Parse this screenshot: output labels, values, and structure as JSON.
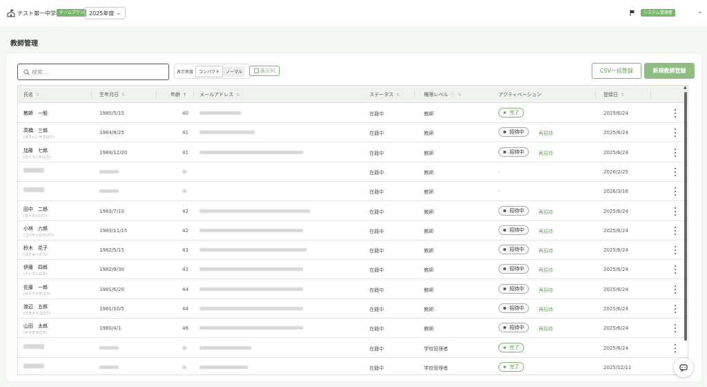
{
  "header": {
    "school_name": "テスト第一中学校",
    "plan_badge": "チームプラン",
    "year": "2025年度",
    "role_badge": "システム管理者"
  },
  "page": {
    "title": "教師管理"
  },
  "toolbar": {
    "search_placeholder": "検索...",
    "density_label": "表示密度",
    "density_options": [
      "コンパクト",
      "ノーマル"
    ],
    "density_selected": "コンパクト",
    "columns_label": "表示列",
    "csv_label": "CSV一括登録",
    "new_label": "新規教師登録"
  },
  "table": {
    "headers": {
      "name": "氏名",
      "birth": "生年月日",
      "age": "年齢",
      "email": "メールアドレス",
      "status": "ステータス",
      "role": "権限レベル",
      "activation": "アクティベーション",
      "registered": "登録日"
    },
    "rows": [
      {
        "name": "教師　一般",
        "kana": "",
        "birth": "1985/5/15",
        "age": "40",
        "status": "在籍中",
        "role": "教師",
        "activation": "完了",
        "activation_type": "done",
        "reinvite": "",
        "registered": "2025/6/24"
      },
      {
        "name": "高橋　三郎",
        "kana": "(タカハシサブロウ)",
        "birth": "1984/8/25",
        "age": "41",
        "status": "在籍中",
        "role": "教師",
        "activation": "招待中",
        "activation_type": "invite",
        "reinvite": "再招待",
        "registered": "2025/6/24"
      },
      {
        "name": "加藤　七郎",
        "kana": "(カトウシチロウ)",
        "birth": "1984/12/20",
        "age": "41",
        "status": "在籍中",
        "role": "教師",
        "activation": "招待中",
        "activation_type": "invite",
        "reinvite": "再招待",
        "registered": "2025/6/24"
      },
      {
        "name": "",
        "kana": "",
        "birth": "",
        "age": "",
        "status": "在籍中",
        "role": "教師",
        "activation": "-",
        "activation_type": "none",
        "reinvite": "",
        "registered": "2026/2/25"
      },
      {
        "name": "",
        "kana": "",
        "birth": "",
        "age": "",
        "status": "在籍中",
        "role": "教師",
        "activation": "-",
        "activation_type": "none",
        "reinvite": "",
        "registered": "2026/3/16"
      },
      {
        "name": "田中　二郎",
        "kana": "(タナカジロウ)",
        "birth": "1983/7/10",
        "age": "42",
        "status": "在籍中",
        "role": "教師",
        "activation": "招待中",
        "activation_type": "invite",
        "reinvite": "再招待",
        "registered": "2025/6/24"
      },
      {
        "name": "小林　六郎",
        "kana": "(コバヤシロクロウ)",
        "birth": "1983/11/15",
        "age": "42",
        "status": "在籍中",
        "role": "教師",
        "activation": "招待中",
        "activation_type": "invite",
        "reinvite": "再招待",
        "registered": "2025/6/24"
      },
      {
        "name": "鈴木　花子",
        "kana": "(スズキハナコ)",
        "birth": "1982/5/15",
        "age": "43",
        "status": "在籍中",
        "role": "教師",
        "activation": "招待中",
        "activation_type": "invite",
        "reinvite": "再招待",
        "registered": "2025/6/24"
      },
      {
        "name": "伊藤　四郎",
        "kana": "(イトウシロウ)",
        "birth": "1982/9/30",
        "age": "43",
        "status": "在籍中",
        "role": "教師",
        "activation": "招待中",
        "activation_type": "invite",
        "reinvite": "再招待",
        "registered": "2025/6/24"
      },
      {
        "name": "佐藤　一郎",
        "kana": "(サトウイチロウ)",
        "birth": "1981/6/20",
        "age": "44",
        "status": "在籍中",
        "role": "教師",
        "activation": "招待中",
        "activation_type": "invite",
        "reinvite": "再招待",
        "registered": "2025/6/24"
      },
      {
        "name": "渡辺　五郎",
        "kana": "(ワタナベゴロウ)",
        "birth": "1981/10/5",
        "age": "44",
        "status": "在籍中",
        "role": "教師",
        "activation": "招待中",
        "activation_type": "invite",
        "reinvite": "再招待",
        "registered": "2025/6/24"
      },
      {
        "name": "山田　太郎",
        "kana": "(ヤマダタロウ)",
        "birth": "1980/4/1",
        "age": "46",
        "status": "在籍中",
        "role": "教師",
        "activation": "招待中",
        "activation_type": "invite",
        "reinvite": "再招待",
        "registered": "2025/6/24"
      },
      {
        "name": "",
        "kana": "",
        "birth": "",
        "age": "",
        "status": "在籍中",
        "role": "学校管理者",
        "activation": "完了",
        "activation_type": "done",
        "reinvite": "",
        "registered": "2025/6/24"
      },
      {
        "name": "",
        "kana": "",
        "birth": "",
        "age": "",
        "status": "在籍中",
        "role": "学校管理者",
        "activation": "完了",
        "activation_type": "done",
        "reinvite": "",
        "registered": "2025/12/11"
      }
    ]
  },
  "colors": {
    "accent": "#7cb66e",
    "accent_dark": "#5a9a4c",
    "primary_button": "#8dbd80"
  },
  "icons": [
    "school-icon",
    "chevron-down-icon",
    "flag-icon",
    "search-icon",
    "columns-icon",
    "sort-icon",
    "help-icon",
    "more-vertical-icon",
    "chat-icon"
  ]
}
